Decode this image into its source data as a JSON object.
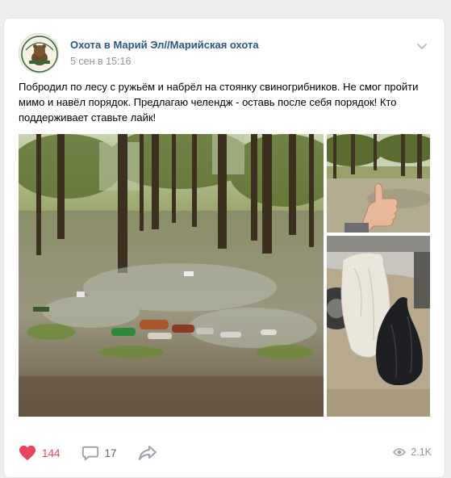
{
  "post": {
    "group_name": "Охота в Марий Эл//Марийская охота",
    "time": "5 сен в 15:16",
    "text": "Побродил по лесу с ружьём и набрёл на стоянку свиногрибников. Не смог пройти мимо и навёл порядок. Предлагаю челендж - оставь после себя порядок! Кто поддерживает ставьте лайк!",
    "avatar_text": "ОХОТА В МАРИЙ ЭЛ"
  },
  "actions": {
    "likes": "144",
    "comments": "17",
    "views": "2.1K"
  },
  "colors": {
    "link": "#2a5885",
    "like": "#e6455c",
    "icon": "#99a2ad"
  },
  "icons": {
    "more": "chevron-down-icon",
    "like": "heart-icon",
    "comment": "comment-icon",
    "share": "share-arrow-icon",
    "views": "eye-icon"
  }
}
